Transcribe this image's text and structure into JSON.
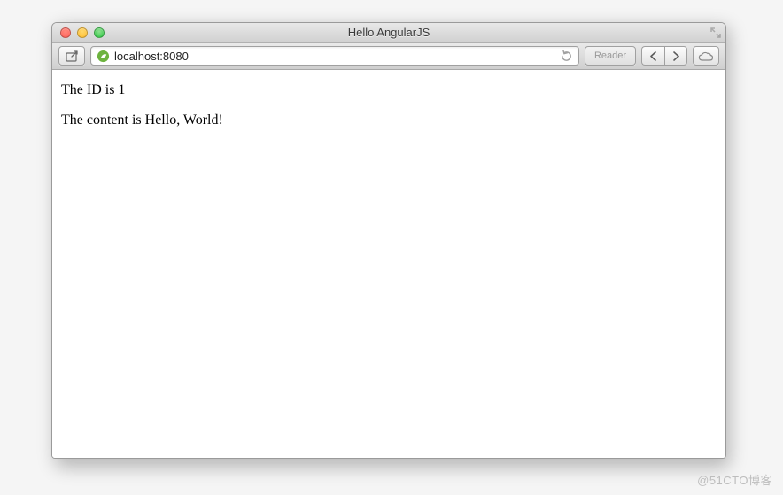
{
  "window": {
    "title": "Hello AngularJS"
  },
  "toolbar": {
    "share_label": "Share",
    "url": "localhost:8080",
    "reader_label": "Reader",
    "reload_label": "Reload",
    "back_label": "Back",
    "forward_label": "Forward",
    "icloud_label": "iCloud Tabs"
  },
  "page": {
    "id_line": "The ID is 1",
    "content_line": "The content is Hello, World!"
  },
  "watermark": "@51CTO博客"
}
